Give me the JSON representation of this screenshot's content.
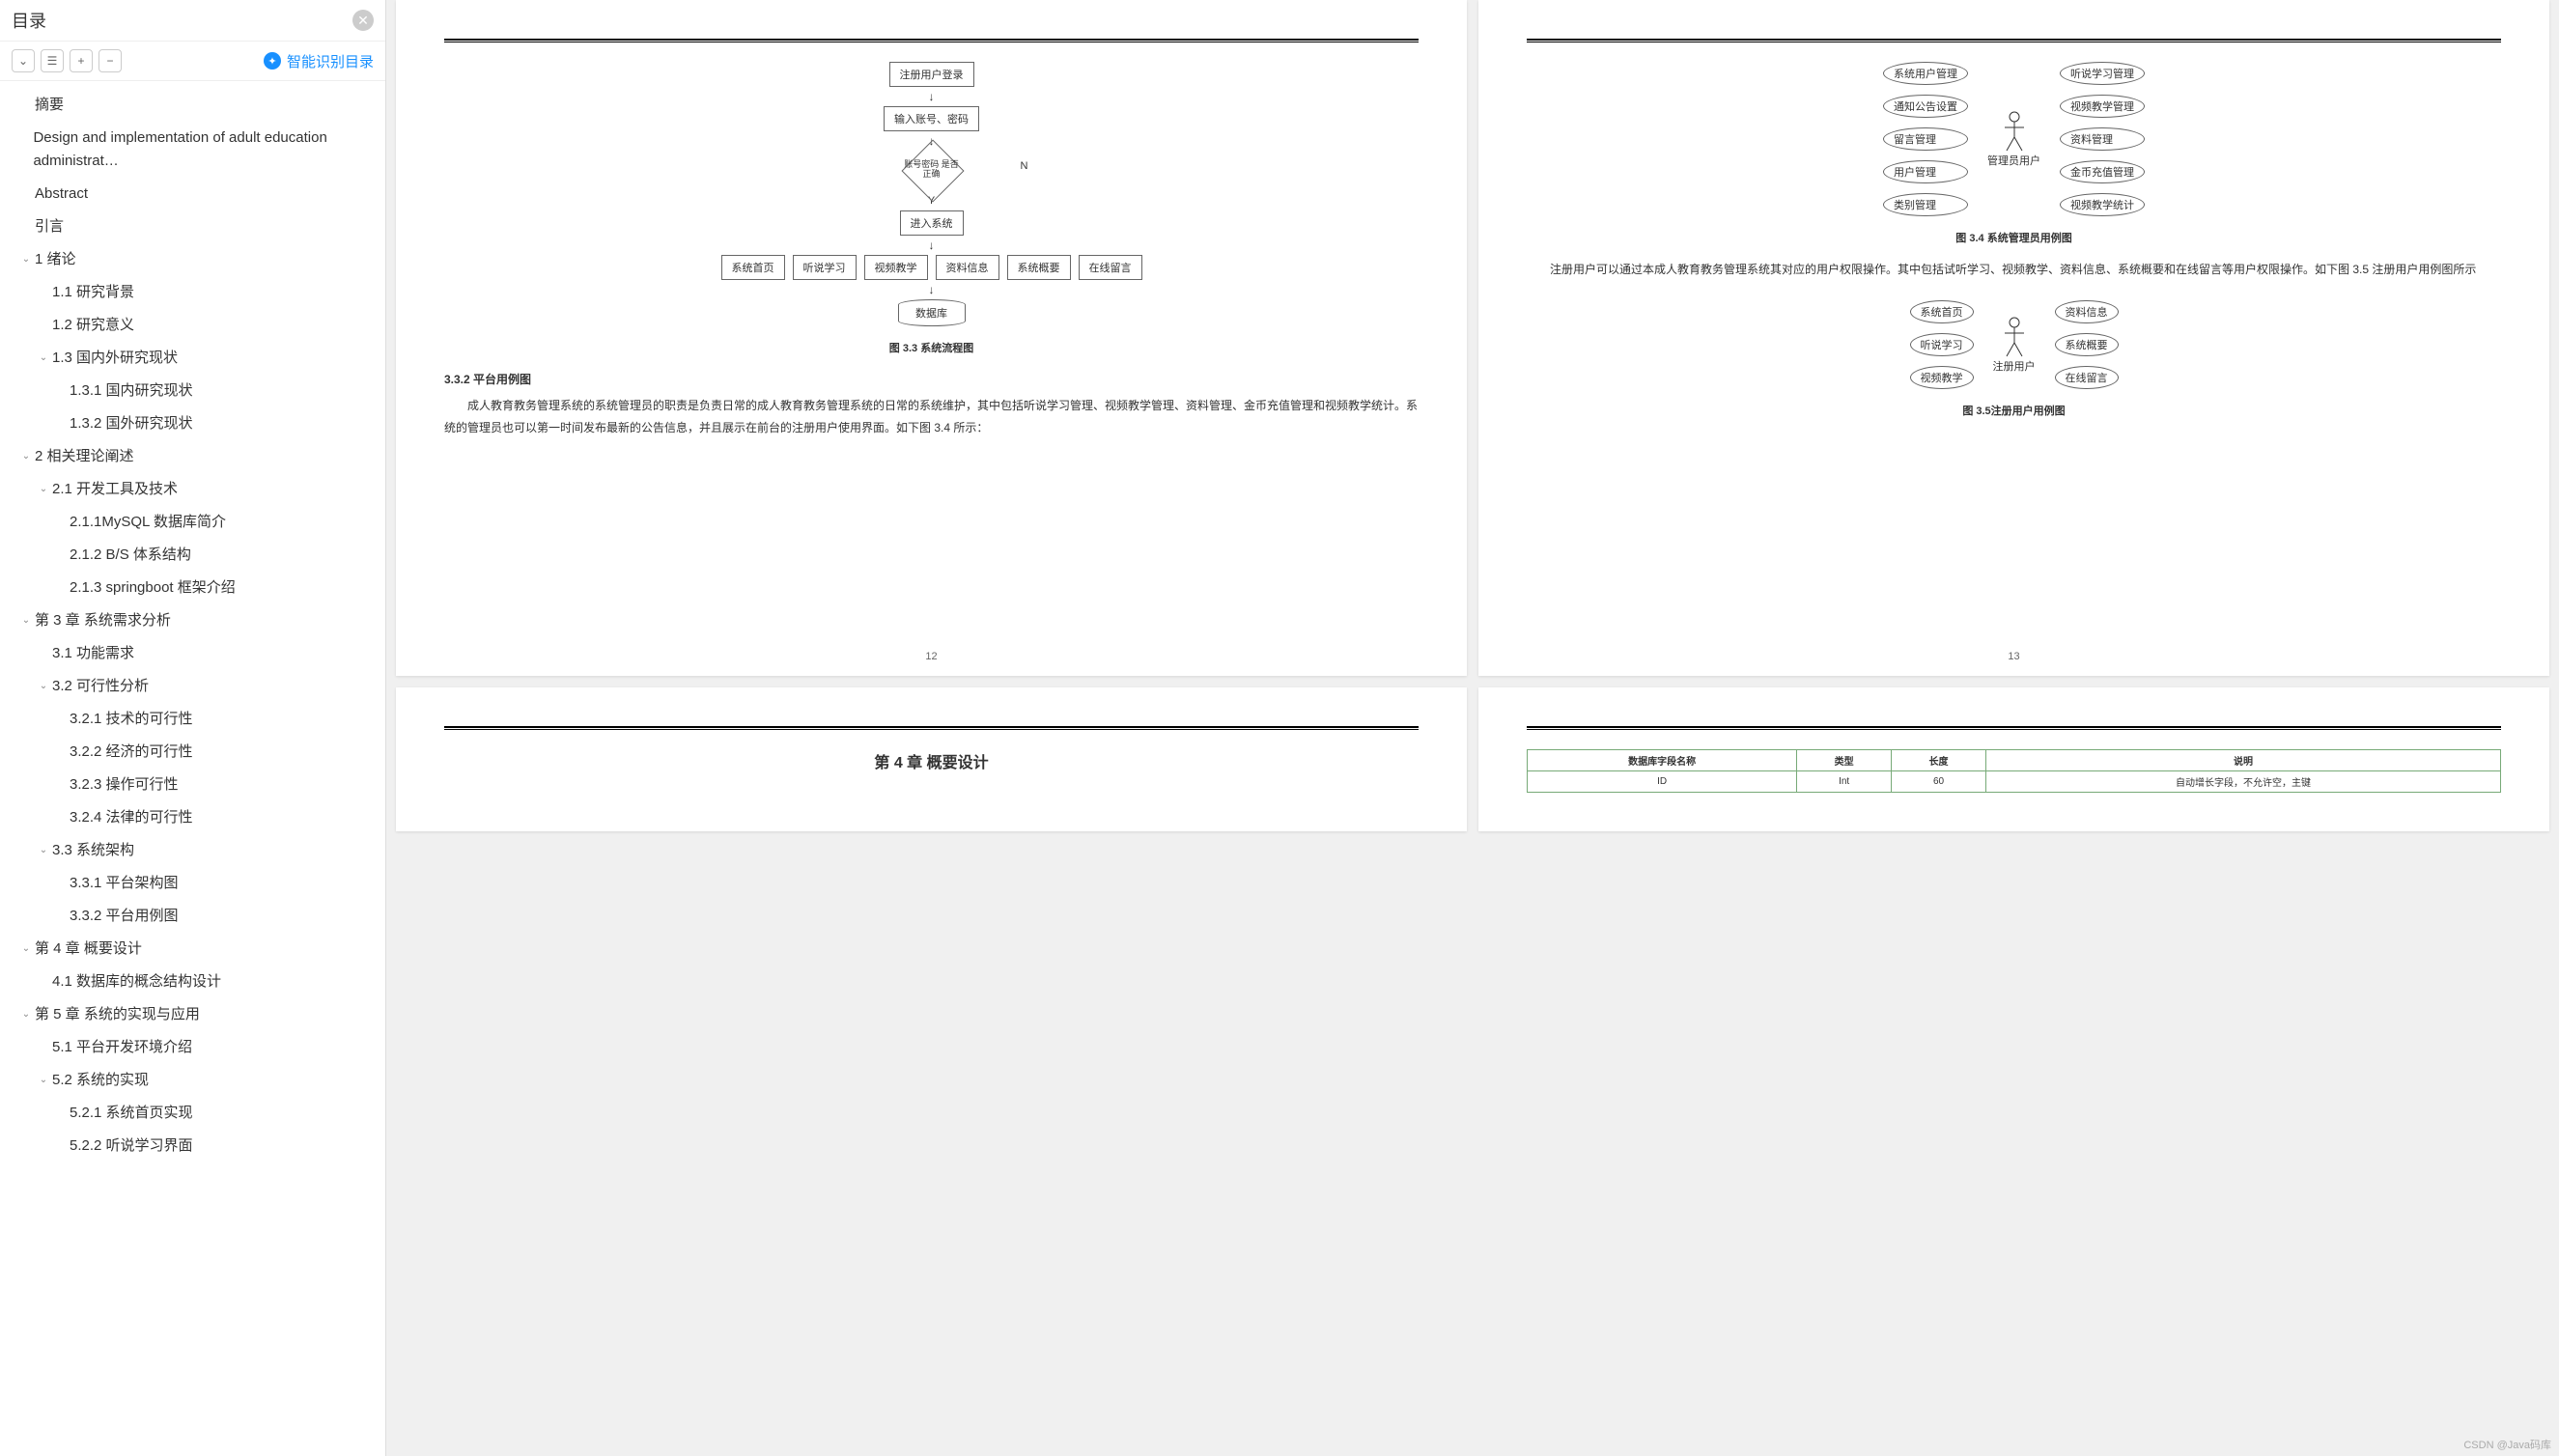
{
  "sidebar": {
    "title": "目录",
    "smart_recog": "智能识别目录",
    "items": [
      {
        "label": "摘要",
        "level": 0,
        "caret": ""
      },
      {
        "label": "Design and implementation of adult education administrat…",
        "level": 0,
        "caret": ""
      },
      {
        "label": "Abstract",
        "level": 0,
        "caret": ""
      },
      {
        "label": "引言",
        "level": 0,
        "caret": ""
      },
      {
        "label": "1 绪论",
        "level": 0,
        "caret": "v"
      },
      {
        "label": "1.1 研究背景",
        "level": 1,
        "caret": ""
      },
      {
        "label": "1.2 研究意义",
        "level": 1,
        "caret": ""
      },
      {
        "label": "1.3 国内外研究现状",
        "level": 1,
        "caret": "v"
      },
      {
        "label": "1.3.1 国内研究现状",
        "level": 2,
        "caret": ""
      },
      {
        "label": "1.3.2 国外研究现状",
        "level": 2,
        "caret": ""
      },
      {
        "label": "2 相关理论阐述",
        "level": 0,
        "caret": "v"
      },
      {
        "label": "2.1 开发工具及技术",
        "level": 1,
        "caret": "v"
      },
      {
        "label": "2.1.1MySQL 数据库简介",
        "level": 2,
        "caret": ""
      },
      {
        "label": "2.1.2 B/S 体系结构",
        "level": 2,
        "caret": ""
      },
      {
        "label": "2.1.3 springboot 框架介绍",
        "level": 2,
        "caret": ""
      },
      {
        "label": "第 3 章  系统需求分析",
        "level": 0,
        "caret": "v"
      },
      {
        "label": "3.1 功能需求",
        "level": 1,
        "caret": ""
      },
      {
        "label": "3.2  可行性分析",
        "level": 1,
        "caret": "v"
      },
      {
        "label": "3.2.1 技术的可行性",
        "level": 2,
        "caret": ""
      },
      {
        "label": "3.2.2 经济的可行性",
        "level": 2,
        "caret": ""
      },
      {
        "label": "3.2.3 操作可行性",
        "level": 2,
        "caret": ""
      },
      {
        "label": "3.2.4 法律的可行性",
        "level": 2,
        "caret": ""
      },
      {
        "label": "3.3 系统架构",
        "level": 1,
        "caret": "v"
      },
      {
        "label": "3.3.1 平台架构图",
        "level": 2,
        "caret": ""
      },
      {
        "label": "3.3.2 平台用例图",
        "level": 2,
        "caret": ""
      },
      {
        "label": "第 4 章  概要设计",
        "level": 0,
        "caret": "v"
      },
      {
        "label": "4.1 数据库的概念结构设计",
        "level": 1,
        "caret": ""
      },
      {
        "label": "第 5 章  系统的实现与应用",
        "level": 0,
        "caret": "v"
      },
      {
        "label": "5.1 平台开发环境介绍",
        "level": 1,
        "caret": ""
      },
      {
        "label": "5.2 系统的实现",
        "level": 1,
        "caret": "v"
      },
      {
        "label": "5.2.1 系统首页实现",
        "level": 2,
        "caret": ""
      },
      {
        "label": "5.2.2 听说学习界面",
        "level": 2,
        "caret": ""
      }
    ]
  },
  "page12": {
    "num": "12",
    "flow": {
      "n1": "注册用户登录",
      "n2": "输入账号、密码",
      "n3": "账号密码\n是否正确",
      "n4": "进入系统",
      "yes": "Y",
      "no": "N",
      "leaves": [
        "系统首页",
        "听说学习",
        "视频教学",
        "资料信息",
        "系统概要",
        "在线留言"
      ],
      "db": "数据库"
    },
    "cap1": "图 3.3 系统流程图",
    "sec": "3.3.2  平台用例图",
    "body": "成人教育教务管理系统的系统管理员的职责是负责日常的成人教育教务管理系统的日常的系统维护，其中包括听说学习管理、视频教学管理、资料管理、金币充值管理和视频教学统计。系统的管理员也可以第一时间发布最新的公告信息，并且展示在前台的注册用户使用界面。如下图 3.4 所示："
  },
  "page13": {
    "num": "13",
    "uc_admin": {
      "left": [
        "系统用户管理",
        "通知公告设置",
        "留言管理",
        "用户管理",
        "类别管理"
      ],
      "right": [
        "听说学习管理",
        "视频教学管理",
        "资料管理",
        "金币充值管理",
        "视频教学统计"
      ],
      "actor": "管理员用户"
    },
    "cap1": "图 3.4 系统管理员用例图",
    "body": "注册用户可以通过本成人教育教务管理系统其对应的用户权限操作。其中包括试听学习、视频教学、资料信息、系统概要和在线留言等用户权限操作。如下图 3.5 注册用户用例图所示",
    "uc_user": {
      "left": [
        "系统首页",
        "听说学习",
        "视频教学"
      ],
      "right": [
        "资料信息",
        "系统概要",
        "在线留言"
      ],
      "actor": "注册用户"
    },
    "cap2": "图 3.5注册用户用例图"
  },
  "page14": {
    "title": "第 4 章  概要设计"
  },
  "page15": {
    "table": {
      "headers": [
        "数据库字段名称",
        "类型",
        "长度",
        "说明"
      ],
      "row": [
        "ID",
        "Int",
        "60",
        "自动增长字段，不允许空，主键"
      ]
    }
  },
  "watermark": "CSDN @Java码库"
}
